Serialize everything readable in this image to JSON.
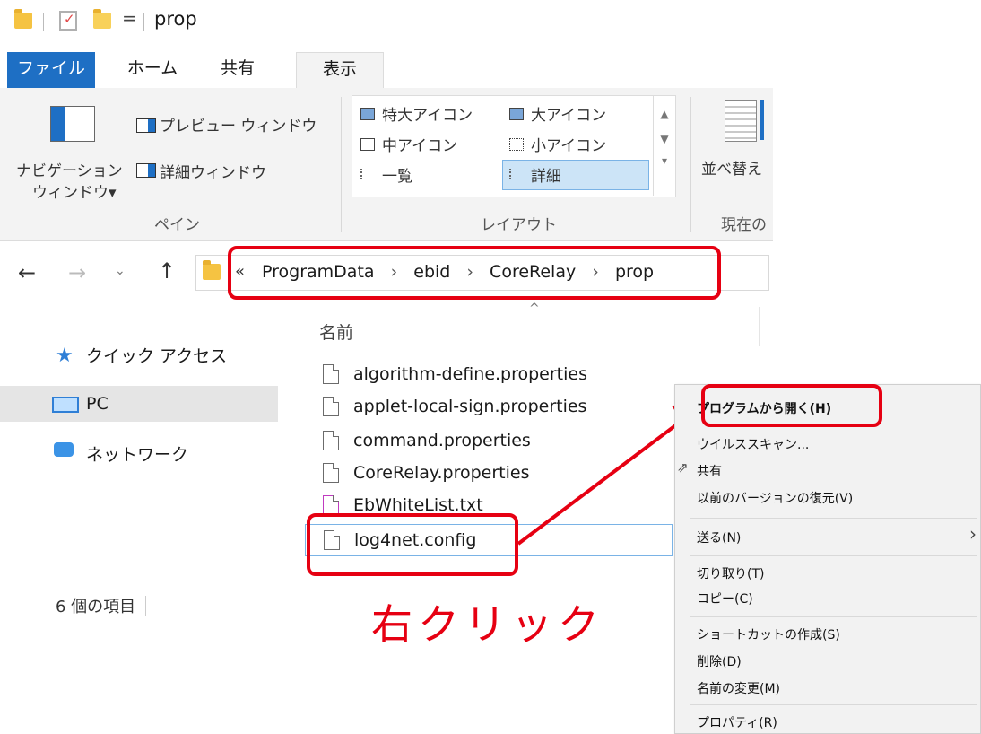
{
  "title_bar": {
    "title": "prop",
    "dropdown_glyph": "="
  },
  "tabs": [
    {
      "label": "ファイル"
    },
    {
      "label": "ホーム"
    },
    {
      "label": "共有"
    },
    {
      "label": "表示"
    }
  ],
  "ribbon": {
    "pane": {
      "nav_line1": "ナビゲーション",
      "nav_line2": "ウィンドウ▾",
      "preview": "プレビュー ウィンドウ",
      "details": "詳細ウィンドウ",
      "group_title": "ペイン"
    },
    "layout": {
      "xlarge": "特大アイコン",
      "large": "大アイコン",
      "medium": "中アイコン",
      "small": "小アイコン",
      "list": "一覧",
      "details": "詳細",
      "group_title": "レイアウト"
    },
    "view": {
      "sort": "並べ替え",
      "group_title": "現在の"
    }
  },
  "address": {
    "overflow": "«",
    "crumbs": [
      "ProgramData",
      "ebid",
      "CoreRelay",
      "prop"
    ],
    "separator": "›"
  },
  "sidebar": {
    "items": [
      {
        "label": "クイック アクセス",
        "icon": "star-icon"
      },
      {
        "label": "PC",
        "icon": "computer-icon"
      },
      {
        "label": "ネットワーク",
        "icon": "network-icon"
      }
    ]
  },
  "file_list": {
    "header": "名前",
    "files": [
      "algorithm-define.properties",
      "applet-local-sign.properties",
      "command.properties",
      "CoreRelay.properties",
      "EbWhiteList.txt",
      "log4net.config"
    ]
  },
  "status": {
    "count": "6 個の項目"
  },
  "context_menu": {
    "items": [
      "プログラムから開く(H)",
      "ウイルススキャン...",
      "共有",
      "以前のバージョンの復元(V)",
      "送る(N)",
      "切り取り(T)",
      "コピー(C)",
      "ショートカットの作成(S)",
      "削除(D)",
      "名前の変更(M)",
      "プロパティ(R)"
    ],
    "submenu_arrow": "›"
  },
  "annotation": {
    "text": "右クリック",
    "color": "#e60012"
  },
  "colors": {
    "file_tab": "#1e6fc4",
    "ribbon_bg": "#f3f3f3",
    "selected_bg": "#cce4f7"
  }
}
